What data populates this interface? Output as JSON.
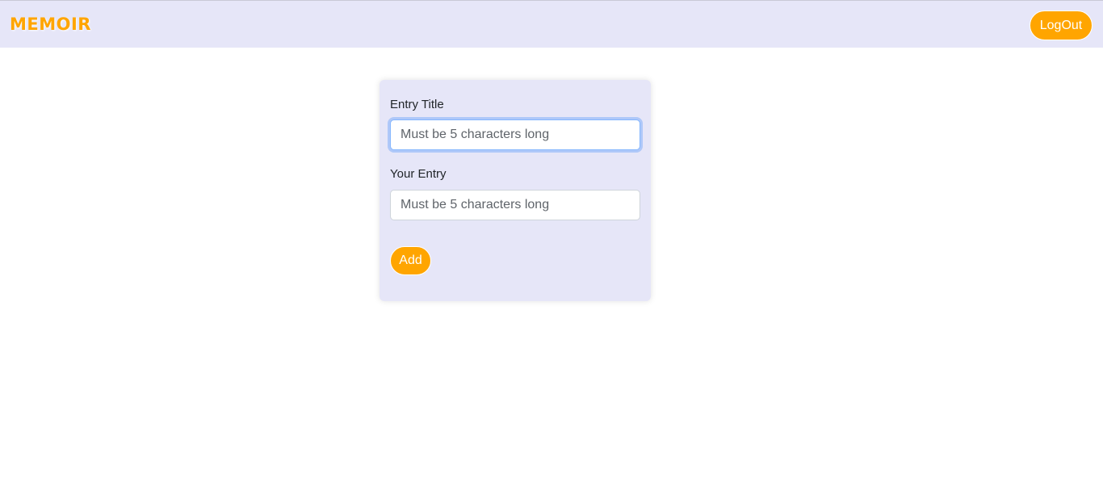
{
  "navbar": {
    "brand": "MEMOIR",
    "logout_label": "LogOut"
  },
  "form": {
    "title_label": "Entry Title",
    "title_placeholder": "Must be 5 characters long",
    "title_value": "",
    "entry_label": "Your Entry",
    "entry_placeholder": "Must be 5 characters long",
    "entry_value": "",
    "add_label": "Add"
  },
  "colors": {
    "accent": "#ffa500",
    "navbar_bg": "#e6e6f8",
    "card_bg": "#e6e6f8",
    "focus_ring": "#86b7fe"
  }
}
